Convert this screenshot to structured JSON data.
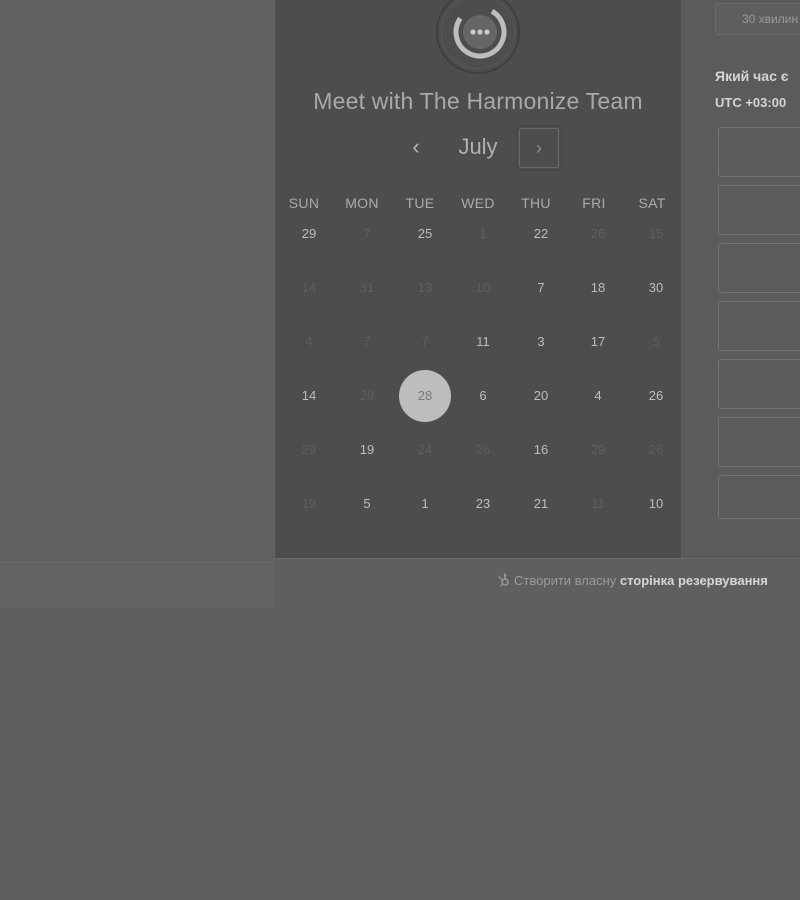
{
  "calendar": {
    "title": "Meet with The Harmonize Team",
    "month": "July",
    "prev_symbol": "‹",
    "next_symbol": "›",
    "weekdays": [
      "SUN",
      "MON",
      "TUE",
      "WED",
      "THU",
      "FRI",
      "SAT"
    ],
    "weeks": [
      [
        {
          "d": "29",
          "s": "on"
        },
        {
          "d": "7",
          "s": "off"
        },
        {
          "d": "25",
          "s": "on"
        },
        {
          "d": "1",
          "s": "off"
        },
        {
          "d": "22",
          "s": "on"
        },
        {
          "d": "26",
          "s": "off"
        },
        {
          "d": "15",
          "s": "off"
        }
      ],
      [
        {
          "d": "14",
          "s": "off"
        },
        {
          "d": "31",
          "s": "off"
        },
        {
          "d": "13",
          "s": "off"
        },
        {
          "d": "10",
          "s": "off"
        },
        {
          "d": "7",
          "s": "on"
        },
        {
          "d": "18",
          "s": "on"
        },
        {
          "d": "30",
          "s": "on"
        }
      ],
      [
        {
          "d": "4",
          "s": "off"
        },
        {
          "d": "7",
          "s": "off"
        },
        {
          "d": "7",
          "s": "off"
        },
        {
          "d": "11",
          "s": "on"
        },
        {
          "d": "3",
          "s": "on"
        },
        {
          "d": "17",
          "s": "on"
        },
        {
          "d": "5",
          "s": "off"
        }
      ],
      [
        {
          "d": "14",
          "s": "on"
        },
        {
          "d": "29",
          "s": "off"
        },
        {
          "d": "28",
          "s": "selected"
        },
        {
          "d": "6",
          "s": "on"
        },
        {
          "d": "20",
          "s": "on"
        },
        {
          "d": "4",
          "s": "on"
        },
        {
          "d": "26",
          "s": "on"
        }
      ],
      [
        {
          "d": "29",
          "s": "off"
        },
        {
          "d": "19",
          "s": "on"
        },
        {
          "d": "24",
          "s": "off"
        },
        {
          "d": "26",
          "s": "off"
        },
        {
          "d": "16",
          "s": "on"
        },
        {
          "d": "29",
          "s": "off"
        },
        {
          "d": "26",
          "s": "off"
        }
      ],
      [
        {
          "d": "19",
          "s": "off"
        },
        {
          "d": "5",
          "s": "on"
        },
        {
          "d": "1",
          "s": "on"
        },
        {
          "d": "23",
          "s": "on"
        },
        {
          "d": "21",
          "s": "on"
        },
        {
          "d": "11",
          "s": "off"
        },
        {
          "d": "10",
          "s": "on"
        }
      ]
    ]
  },
  "times": {
    "duration_label": "30 хвилин",
    "question": "Який час є",
    "timezone": "UTC +03:00"
  },
  "footer": {
    "prefix": "Створити власну ",
    "bold": "сторінка резервування"
  },
  "icons": {
    "avatar": "chat-bubble-icon",
    "footer": "hubspot-sprocket-icon"
  }
}
